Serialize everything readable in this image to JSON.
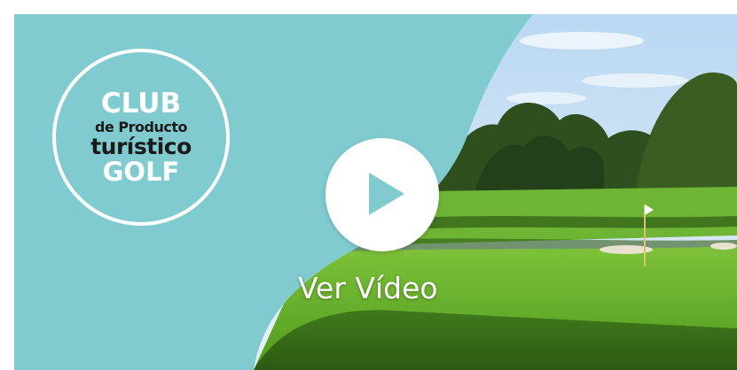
{
  "logo": {
    "club": "CLUB",
    "de_producto": "de Producto",
    "turistico": "turístico",
    "golf": "GOLF"
  },
  "video": {
    "label": "Ver Vídeo"
  },
  "icons": {
    "play": "play-icon"
  },
  "colors": {
    "brand_teal": "#7fcbd0",
    "logo_white": "#ffffff",
    "logo_dark": "#1a1a1a"
  }
}
